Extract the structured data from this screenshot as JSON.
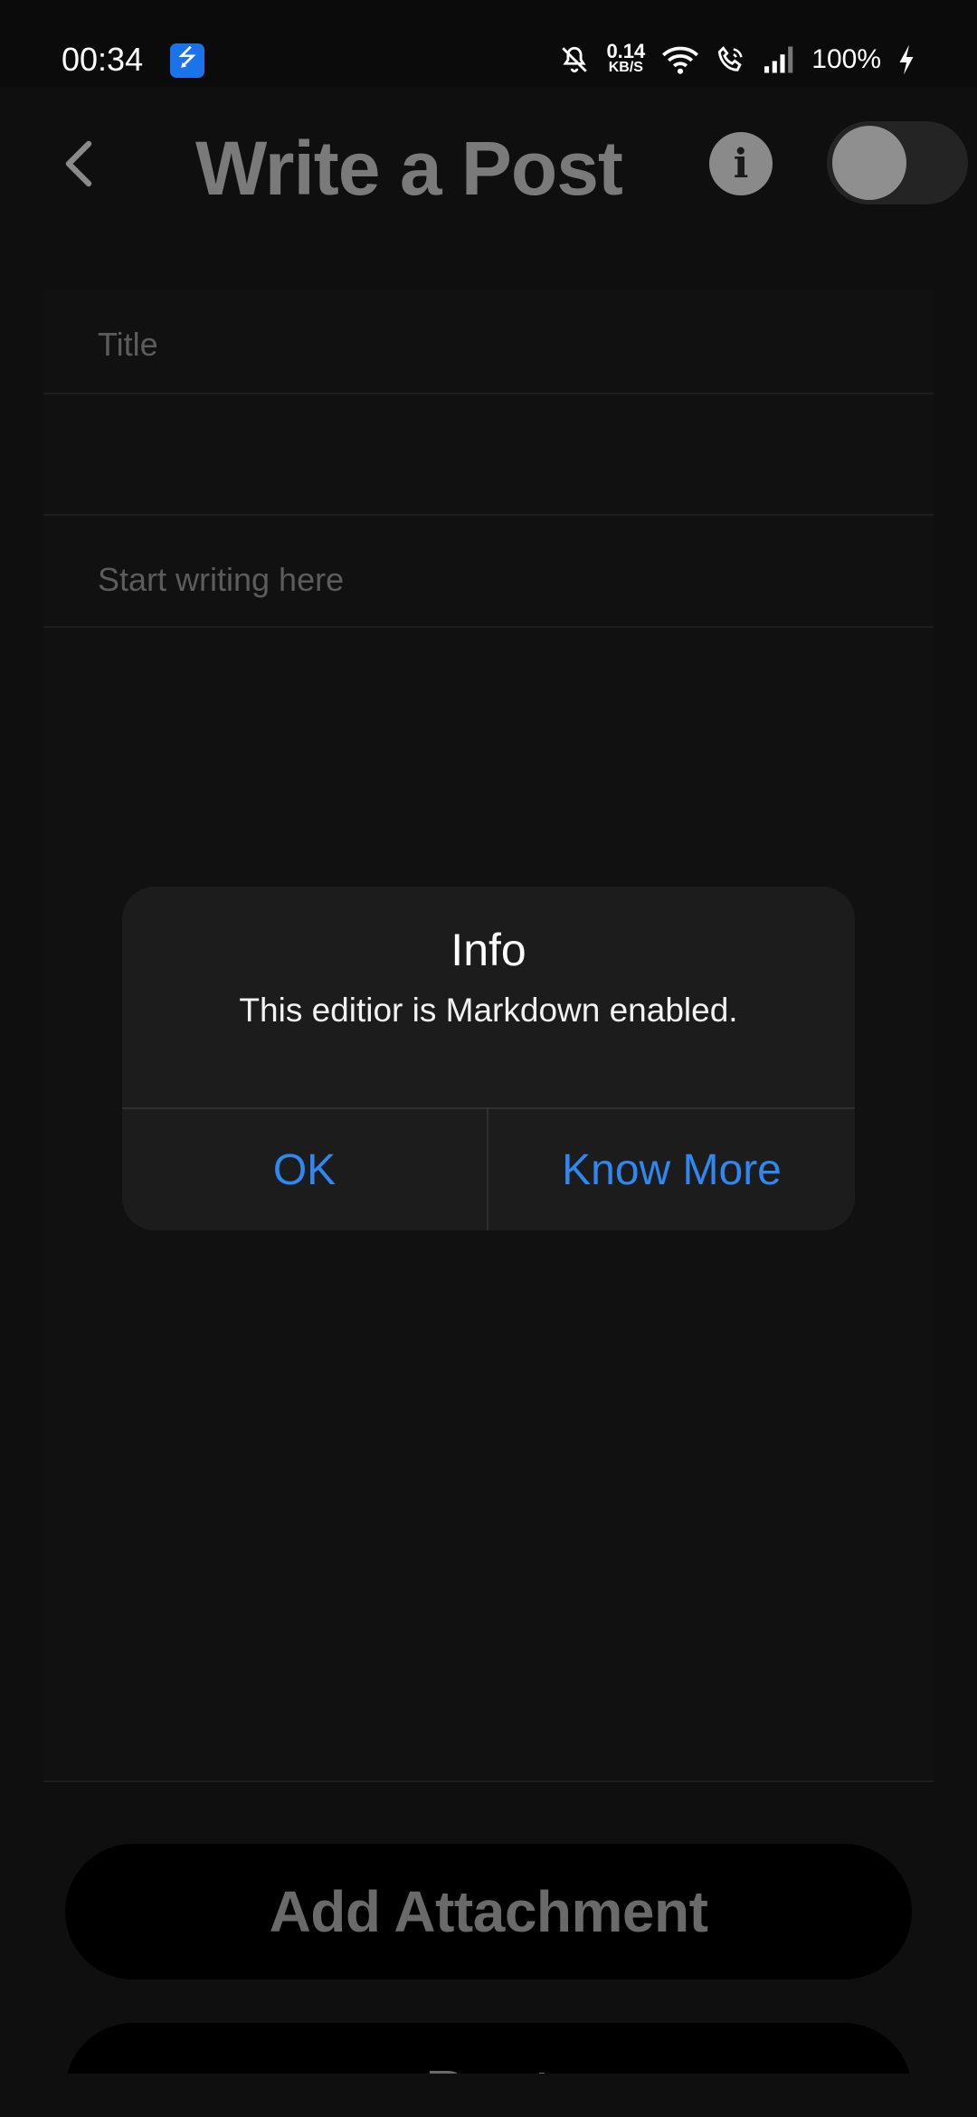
{
  "status_bar": {
    "time": "00:34",
    "net_speed_value": "0.14",
    "net_speed_unit": "KB/S",
    "battery": "100%",
    "icons": [
      "usb-icon",
      "mute-icon",
      "wifi-icon",
      "wifi-calling-icon",
      "signal-icon",
      "charging-icon"
    ]
  },
  "header": {
    "title": "Write a Post",
    "info_label": "i",
    "toggle_on": false
  },
  "form": {
    "title_placeholder": "Title",
    "body_placeholder": "Start writing here"
  },
  "buttons": {
    "attachment": "Add Attachment",
    "post": "Post"
  },
  "dialog": {
    "title": "Info",
    "message": "This editior is Markdown enabled.",
    "ok": "OK",
    "know_more": "Know More"
  },
  "colors": {
    "accent": "#2f88f0",
    "usb_badge": "#1a73e8",
    "background": "#0f0f0f",
    "dialog": "#1c1c1c"
  }
}
